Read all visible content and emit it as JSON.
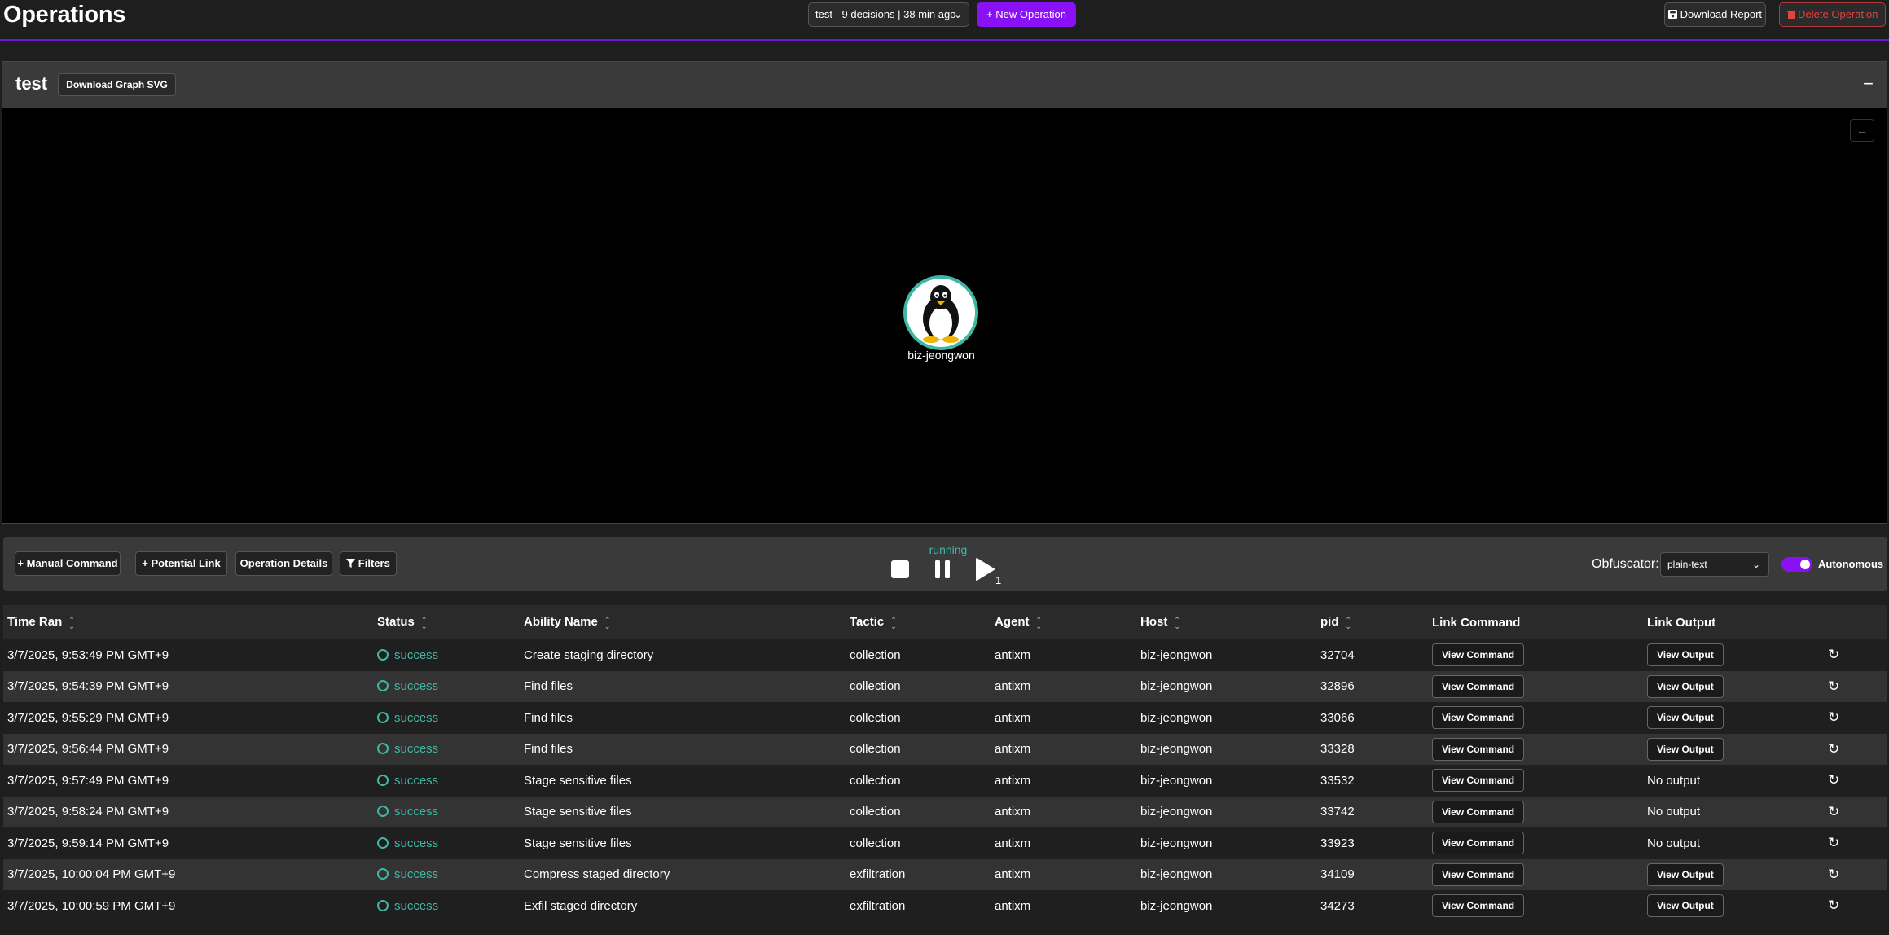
{
  "header": {
    "title": "Operations",
    "operation_select": "test - 9 decisions | 38 min ago",
    "new_operation": "New Operation",
    "download_report": "Download Report",
    "delete_operation": "Delete Operation"
  },
  "graph": {
    "title": "test",
    "download_svg": "Download Graph SVG",
    "minimize": "−",
    "collapse_arrow": "←",
    "node": {
      "label": "biz-jeongwon",
      "icon": "linux-tux-icon"
    }
  },
  "controls": {
    "manual_command": "Manual Command",
    "potential_link": "Potential Link",
    "operation_details": "Operation Details",
    "filters": "Filters",
    "state": "running",
    "play_count": "1",
    "obfuscator_label": "Obfuscator:",
    "obfuscator_value": "plain-text",
    "autonomous_label": "Autonomous",
    "autonomous_on": true
  },
  "table": {
    "columns": [
      "Time Ran",
      "Status",
      "Ability Name",
      "Tactic",
      "Agent",
      "Host",
      "pid",
      "Link Command",
      "Link Output"
    ],
    "view_command": "View Command",
    "view_output": "View Output",
    "no_output": "No output",
    "rows": [
      {
        "time": "3/7/2025, 9:53:49 PM GMT+9",
        "status": "success",
        "ability": "Create staging directory",
        "tactic": "collection",
        "agent": "antixm",
        "host": "biz-jeongwon",
        "pid": "32704",
        "output": "View Output"
      },
      {
        "time": "3/7/2025, 9:54:39 PM GMT+9",
        "status": "success",
        "ability": "Find files",
        "tactic": "collection",
        "agent": "antixm",
        "host": "biz-jeongwon",
        "pid": "32896",
        "output": "View Output"
      },
      {
        "time": "3/7/2025, 9:55:29 PM GMT+9",
        "status": "success",
        "ability": "Find files",
        "tactic": "collection",
        "agent": "antixm",
        "host": "biz-jeongwon",
        "pid": "33066",
        "output": "View Output"
      },
      {
        "time": "3/7/2025, 9:56:44 PM GMT+9",
        "status": "success",
        "ability": "Find files",
        "tactic": "collection",
        "agent": "antixm",
        "host": "biz-jeongwon",
        "pid": "33328",
        "output": "View Output"
      },
      {
        "time": "3/7/2025, 9:57:49 PM GMT+9",
        "status": "success",
        "ability": "Stage sensitive files",
        "tactic": "collection",
        "agent": "antixm",
        "host": "biz-jeongwon",
        "pid": "33532",
        "output": "No output"
      },
      {
        "time": "3/7/2025, 9:58:24 PM GMT+9",
        "status": "success",
        "ability": "Stage sensitive files",
        "tactic": "collection",
        "agent": "antixm",
        "host": "biz-jeongwon",
        "pid": "33742",
        "output": "No output"
      },
      {
        "time": "3/7/2025, 9:59:14 PM GMT+9",
        "status": "success",
        "ability": "Stage sensitive files",
        "tactic": "collection",
        "agent": "antixm",
        "host": "biz-jeongwon",
        "pid": "33923",
        "output": "No output"
      },
      {
        "time": "3/7/2025, 10:00:04 PM GMT+9",
        "status": "success",
        "ability": "Compress staged directory",
        "tactic": "exfiltration",
        "agent": "antixm",
        "host": "biz-jeongwon",
        "pid": "34109",
        "output": "View Output"
      },
      {
        "time": "3/7/2025, 10:00:59 PM GMT+9",
        "status": "success",
        "ability": "Exfil staged directory",
        "tactic": "exfiltration",
        "agent": "antixm",
        "host": "biz-jeongwon",
        "pid": "34273",
        "output": "View Output"
      }
    ]
  },
  "colors": {
    "accent": "#8a10f5",
    "success": "#3fb7a5",
    "danger": "#e0443c"
  }
}
